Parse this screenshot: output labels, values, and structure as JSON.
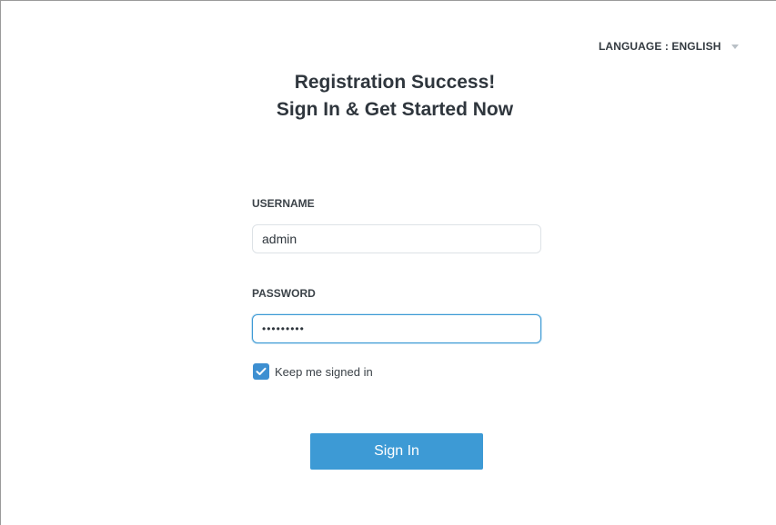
{
  "language": {
    "label": "LANGUAGE : ENGLISH",
    "icon": "caret-down-icon"
  },
  "headline": {
    "line1": "Registration Success!",
    "line2": "Sign In & Get Started Now"
  },
  "form": {
    "username_label": "USERNAME",
    "username_value": "admin",
    "password_label": "PASSWORD",
    "password_value": "•••••••••",
    "remember_label": "Keep me signed in",
    "remember_checked": true,
    "submit_label": "Sign In"
  },
  "colors": {
    "accent": "#3d9ad5",
    "text": "#2f363d"
  }
}
